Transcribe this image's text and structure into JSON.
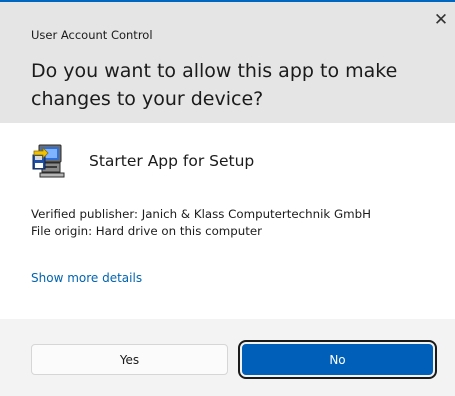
{
  "dialog": {
    "window_title": "User Account Control",
    "question": "Do you want to allow this app to make changes to your device?",
    "close_label": "✕"
  },
  "app": {
    "name": "Starter App for Setup",
    "icon": "setup-computer-icon"
  },
  "details": {
    "publisher": "Verified publisher: Janich & Klass Computertechnik GmbH",
    "origin": "File origin: Hard drive on this computer",
    "show_more": "Show more details"
  },
  "buttons": {
    "yes": "Yes",
    "no": "No"
  },
  "colors": {
    "accent": "#005fb8",
    "link": "#0063b1",
    "header_bg": "#e5e5e5",
    "footer_bg": "#f3f3f3"
  }
}
